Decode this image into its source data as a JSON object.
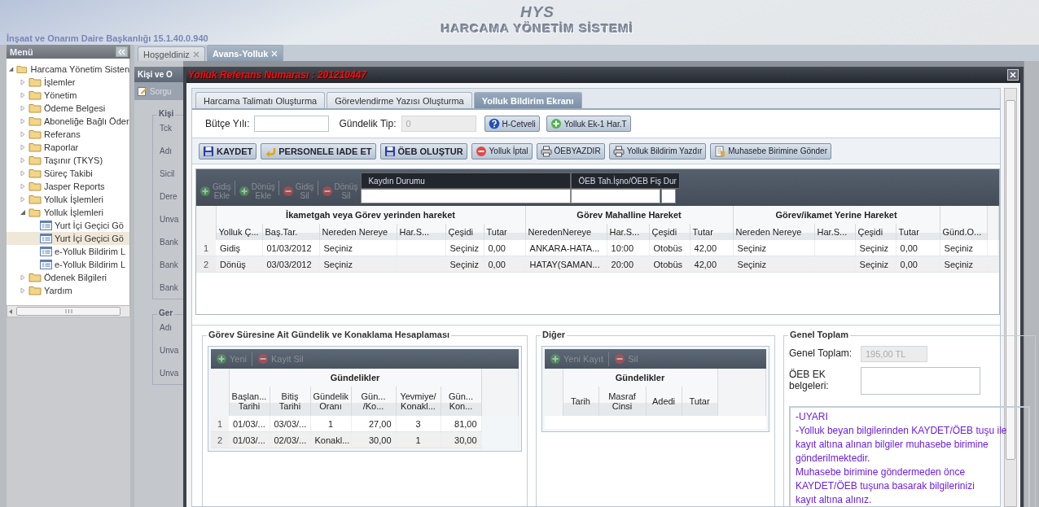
{
  "header": {
    "organization": "İnşaat ve Onarım Daire Başkanlığı 15.1.40.0.940",
    "logo": "HYS",
    "system_name": "HARCAMA YÖNETİM SİSTEMİ"
  },
  "sidebar": {
    "title": "Menü",
    "tree": [
      {
        "label": "Harcama Yönetim Sisten",
        "kind": "folder",
        "expanded": true,
        "selected": false,
        "children": [
          {
            "label": "İşlemler",
            "kind": "folder",
            "expanded": false,
            "selected": false
          },
          {
            "label": "Yönetim",
            "kind": "folder",
            "expanded": false,
            "selected": false
          },
          {
            "label": "Ödeme Belgesi",
            "kind": "folder",
            "expanded": false,
            "selected": false
          },
          {
            "label": "Aboneliğe Bağlı Öder",
            "kind": "folder",
            "expanded": false,
            "selected": false
          },
          {
            "label": "Referans",
            "kind": "folder",
            "expanded": false,
            "selected": false
          },
          {
            "label": "Raporlar",
            "kind": "folder",
            "expanded": false,
            "selected": false
          },
          {
            "label": "Taşınır (TKYS)",
            "kind": "folder",
            "expanded": false,
            "selected": false
          },
          {
            "label": "Süreç Takibi",
            "kind": "folder",
            "expanded": false,
            "selected": false
          },
          {
            "label": "Jasper Reports",
            "kind": "folder",
            "expanded": false,
            "selected": false
          },
          {
            "label": "Yolluk İşlemleri",
            "kind": "folder",
            "expanded": false,
            "selected": false
          },
          {
            "label": "Yolluk İşlemleri",
            "kind": "folder",
            "expanded": true,
            "selected": false,
            "children": [
              {
                "label": "Yurt İçi Geçici Gö",
                "kind": "page",
                "selected": false
              },
              {
                "label": "Yurt İçi Geçici Gö",
                "kind": "page",
                "selected": true
              },
              {
                "label": "e-Yolluk Bildirim L",
                "kind": "page",
                "selected": false
              },
              {
                "label": "e-Yolluk Bildirim L",
                "kind": "page",
                "selected": false
              }
            ]
          },
          {
            "label": "Ödenek Bilgileri",
            "kind": "folder",
            "expanded": false,
            "selected": false
          },
          {
            "label": "Yardım",
            "kind": "folder",
            "expanded": false,
            "selected": false
          }
        ]
      }
    ]
  },
  "tabs": [
    {
      "label": "Hoşgeldiniz",
      "selected": false
    },
    {
      "label": "Avans-Yolluk",
      "selected": true
    }
  ],
  "background_panel": {
    "title": "Kişi ve O",
    "toolbar_button": "Sorgu",
    "sections": [
      {
        "legend": "Kişi",
        "labels": [
          "Tck",
          "Adı",
          "Sicil",
          "Dere",
          "Unva",
          "Bank",
          "Bank",
          "Bank"
        ]
      },
      {
        "legend": "Ger",
        "labels": [
          "Adı",
          "Unva",
          "Unva"
        ]
      }
    ]
  },
  "dialog": {
    "title": "Yolluk Referans Numarası : 201210447",
    "tabs": [
      {
        "label": "Harcama Talimatı Oluşturma",
        "selected": false
      },
      {
        "label": "Görevlendirme Yazısı Oluşturma",
        "selected": false
      },
      {
        "label": "Yolluk Bildirim Ekranı",
        "selected": true
      }
    ],
    "fields": [
      {
        "label": "Bütçe Yılı:",
        "disabled": false
      },
      {
        "label": "Gündelik Tip:",
        "value": "0",
        "disabled": true
      }
    ],
    "buttons": [
      {
        "label": "H-Cetveli",
        "kind": "help"
      },
      {
        "label": "Yolluk Ek-1 Har.T",
        "kind": "add"
      }
    ],
    "toolbar": [
      {
        "label": "KAYDET",
        "kind": "save",
        "primary": true
      },
      {
        "label": "PERSONELE IADE ET",
        "kind": "return",
        "primary": true
      },
      {
        "label": "ÖEB OLUŞTUR",
        "kind": "save",
        "primary": true
      },
      {
        "label": "Yolluk İptal",
        "kind": "remove",
        "primary": false
      },
      {
        "label": "ÖEBYAZDIR",
        "kind": "print",
        "primary": false
      },
      {
        "label": "Yolluk Bildirim Yazdır",
        "kind": "print",
        "primary": false
      },
      {
        "label": "Muhasebe Birimine Gönder",
        "kind": "send",
        "primary": false
      }
    ],
    "grid": {
      "actions": [
        {
          "label": "Gidiş\nEkle",
          "kind": "add",
          "disabled": true
        },
        {
          "label": "Dönüş\nEkle",
          "kind": "add",
          "disabled": true
        },
        {
          "label": "Gidiş\nSil",
          "kind": "remove",
          "disabled": true
        },
        {
          "label": "Dönüş\nSil",
          "kind": "remove",
          "disabled": true
        }
      ],
      "status_fields": [
        {
          "label": "Kaydın Durumu"
        },
        {
          "label": "ÖEB Tah.İşno/ÖEB Fiş Dur"
        }
      ],
      "groups": [
        {
          "label": "İkametgah veya Görev yerinden hareket",
          "columns": [
            "Yolluk Ç...",
            "Baş.Tar.",
            "Nereden Nereye",
            "Har.S...",
            "Çeşidi",
            "Tutar"
          ]
        },
        {
          "label": "Görev Mahalline Hareket",
          "columns": [
            "NeredenNereye",
            "Har.S...",
            "Çeşidi",
            "Tutar"
          ]
        },
        {
          "label": "Görev/ikamet Yerine Hareket",
          "columns": [
            "Nereden Nereye",
            "Har.S...",
            "Çeşidi",
            "Tutar"
          ]
        },
        {
          "columns": [
            "Günd.O..."
          ]
        }
      ],
      "rows": [
        {
          "number": "1",
          "cells": [
            "Gidiş",
            "01/03/2012",
            "Seçiniz",
            "",
            "Seçiniz",
            "0,00",
            "ANKARA-HATA...",
            "10:00",
            "Otobüs",
            "42,00",
            "Seçiniz",
            "",
            "Seçiniz",
            "0,00",
            "Seçiniz"
          ]
        },
        {
          "number": "2",
          "cells": [
            "Dönüş",
            "03/03/2012",
            "Seçiniz",
            "",
            "Seçiniz",
            "0,00",
            "HATAY(SAMAN...",
            "20:00",
            "Otobüs",
            "42,00",
            "Seçiniz",
            "",
            "Seçiniz",
            "0,00",
            "Seçiniz"
          ]
        }
      ]
    },
    "daily": {
      "legend": "Görev Süresine Ait Gündelik ve Konaklama Hesaplaması",
      "actions": [
        {
          "label": "Yeni",
          "kind": "add",
          "disabled": true
        },
        {
          "label": "Kayit Sil",
          "kind": "remove",
          "disabled": true
        }
      ],
      "group": "Gündelikler",
      "columns": [
        "Başlan...\nTarihi",
        "Bitiş\nTarihi",
        "Gündelik\nOranı",
        "Gün...\n/Ko...",
        "Yevmiye/\nKonakl...",
        "Gün...\nKon..."
      ],
      "rows": [
        {
          "number": "1",
          "cells": [
            "01/03/...",
            "03/03/...",
            "1",
            "27,00",
            "3",
            "81,00"
          ]
        },
        {
          "number": "2",
          "cells": [
            "01/03/...",
            "02/03/...",
            "Konakl...",
            "30,00",
            "1",
            "30,00"
          ]
        }
      ]
    },
    "other": {
      "legend": "Diğer",
      "actions": [
        {
          "label": "Yeni Kayıt",
          "kind": "add",
          "disabled": true
        },
        {
          "label": "Sil",
          "kind": "remove",
          "disabled": true
        }
      ],
      "group": "Gündelikler",
      "columns": [
        "Tarih",
        "Masraf\nCinsi",
        "Adedi",
        "Tutar"
      ]
    },
    "total": {
      "legend": "Genel Toplam",
      "fields": [
        {
          "label": "Genel Toplam:",
          "value": "195,00 TL",
          "disabled": true
        },
        {
          "label": "ÖEB EK\nbelgeleri:",
          "disabled": false
        }
      ],
      "notice": "-UYARI\n-Yolluk beyan bilgilerinden KAYDET/ÖEB tuşu ile\nkayıt altına alınan bilgiler muhasebe birimine\ngönderilmektedir.\nMuhasebe birimine göndermeden önce\nKAYDET/ÖEB tuşuna basarak bilgilerinizi\nkayıt altına alınız."
    }
  }
}
